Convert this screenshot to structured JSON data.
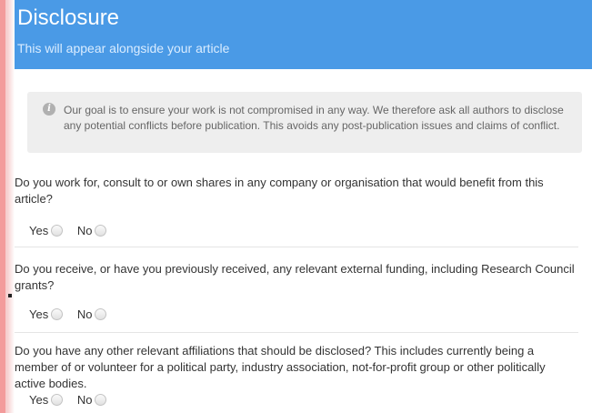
{
  "header": {
    "title": "Disclosure",
    "subtitle": "This will appear alongside your article"
  },
  "info": {
    "icon": "info-icon",
    "text": "Our goal is to ensure your work is not compromised in any way. We therefore ask all authors to disclose any potential conflicts before publication. This avoids any post-publication issues and claims of conflict."
  },
  "questions": [
    {
      "text": "Do you work for, consult to or own shares in any company or organisation that would benefit from this article?",
      "yes_label": "Yes",
      "no_label": "No"
    },
    {
      "text": "Do you receive, or have you previously received, any relevant external funding, including Research Council grants?",
      "yes_label": "Yes",
      "no_label": "No"
    },
    {
      "text": "Do you have any other relevant affiliations that should be disclosed? This includes currently being a member of or volunteer for a political party, industry association, not-for-profit group or other politically active bodies.",
      "yes_label": "Yes",
      "no_label": "No"
    }
  ],
  "colors": {
    "header_bg": "#4a9ae6",
    "header_title": "#ffffff",
    "header_subtitle": "#d9ecff",
    "info_bg": "#eeeeee",
    "left_edge_accent": "#f39b9b"
  }
}
